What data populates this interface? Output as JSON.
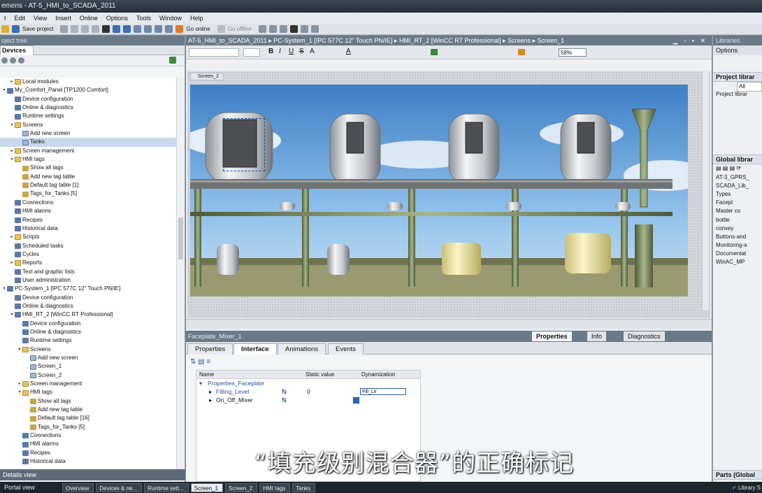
{
  "title": "emens - AT-5_HMI_to_SCADA_2011",
  "menu": [
    "t",
    "Edit",
    "View",
    "Insert",
    "Online",
    "Options",
    "Tools",
    "Window",
    "Help"
  ],
  "toolbar": {
    "save": "Save project",
    "go_online": "Go online",
    "go_offline": "Go offline"
  },
  "left": {
    "panel_title": "oject tree",
    "tab": "Devices",
    "tree": [
      {
        "label": "Local modules",
        "indent": 1,
        "icon": "f",
        "tw": "▸"
      },
      {
        "label": "My_Comfort_Panel [TP1200 Comfort]",
        "indent": 0,
        "icon": "d",
        "tw": "▾"
      },
      {
        "label": "Device configuration",
        "indent": 1,
        "icon": "d",
        "tw": ""
      },
      {
        "label": "Online & diagnostics",
        "indent": 1,
        "icon": "d",
        "tw": ""
      },
      {
        "label": "Runtime settings",
        "indent": 1,
        "icon": "d",
        "tw": ""
      },
      {
        "label": "Screens",
        "indent": 1,
        "icon": "f",
        "tw": "▾"
      },
      {
        "label": "Add new screen",
        "indent": 2,
        "icon": "s",
        "tw": ""
      },
      {
        "label": "Tanks",
        "indent": 2,
        "icon": "s",
        "tw": "",
        "selected": true
      },
      {
        "label": "Screen management",
        "indent": 1,
        "icon": "f",
        "tw": "▸"
      },
      {
        "label": "HMI tags",
        "indent": 1,
        "icon": "f",
        "tw": "▾"
      },
      {
        "label": "Show all tags",
        "indent": 2,
        "icon": "t",
        "tw": ""
      },
      {
        "label": "Add new tag table",
        "indent": 2,
        "icon": "t",
        "tw": ""
      },
      {
        "label": "Default tag table [1]",
        "indent": 2,
        "icon": "t",
        "tw": ""
      },
      {
        "label": "Tags_for_Tanks [5]",
        "indent": 2,
        "icon": "t",
        "tw": ""
      },
      {
        "label": "Connections",
        "indent": 1,
        "icon": "d",
        "tw": ""
      },
      {
        "label": "HMI alarms",
        "indent": 1,
        "icon": "d",
        "tw": ""
      },
      {
        "label": "Recipes",
        "indent": 1,
        "icon": "d",
        "tw": ""
      },
      {
        "label": "Historical data",
        "indent": 1,
        "icon": "d",
        "tw": ""
      },
      {
        "label": "Scripts",
        "indent": 1,
        "icon": "f",
        "tw": "▸"
      },
      {
        "label": "Scheduled tasks",
        "indent": 1,
        "icon": "d",
        "tw": ""
      },
      {
        "label": "Cycles",
        "indent": 1,
        "icon": "d",
        "tw": ""
      },
      {
        "label": "Reports",
        "indent": 1,
        "icon": "f",
        "tw": "▸"
      },
      {
        "label": "Text and graphic lists",
        "indent": 1,
        "icon": "d",
        "tw": ""
      },
      {
        "label": "User administration",
        "indent": 1,
        "icon": "d",
        "tw": ""
      },
      {
        "label": "PC-System_1 [IPC 577C 12\" Touch PN/IE]",
        "indent": 0,
        "icon": "d",
        "tw": "▾"
      },
      {
        "label": "Device configuration",
        "indent": 1,
        "icon": "d",
        "tw": ""
      },
      {
        "label": "Online & diagnostics",
        "indent": 1,
        "icon": "d",
        "tw": ""
      },
      {
        "label": "HMI_RT_2 [WinCC RT Professional]",
        "indent": 1,
        "icon": "d",
        "tw": "▾"
      },
      {
        "label": "Device configuration",
        "indent": 2,
        "icon": "d",
        "tw": ""
      },
      {
        "label": "Online & diagnostics",
        "indent": 2,
        "icon": "d",
        "tw": ""
      },
      {
        "label": "Runtime settings",
        "indent": 2,
        "icon": "d",
        "tw": ""
      },
      {
        "label": "Screens",
        "indent": 2,
        "icon": "f",
        "tw": "▾"
      },
      {
        "label": "Add new screen",
        "indent": 3,
        "icon": "s",
        "tw": ""
      },
      {
        "label": "Screen_1",
        "indent": 3,
        "icon": "s",
        "tw": ""
      },
      {
        "label": "Screen_2",
        "indent": 3,
        "icon": "s",
        "tw": ""
      },
      {
        "label": "Screen management",
        "indent": 2,
        "icon": "f",
        "tw": "▸"
      },
      {
        "label": "HMI tags",
        "indent": 2,
        "icon": "f",
        "tw": "▾"
      },
      {
        "label": "Show all tags",
        "indent": 3,
        "icon": "t",
        "tw": ""
      },
      {
        "label": "Add new tag table",
        "indent": 3,
        "icon": "t",
        "tw": ""
      },
      {
        "label": "Default tag table [16]",
        "indent": 3,
        "icon": "t",
        "tw": ""
      },
      {
        "label": "Tags_for_Tanks [5]",
        "indent": 3,
        "icon": "t",
        "tw": ""
      },
      {
        "label": "Connections",
        "indent": 2,
        "icon": "d",
        "tw": ""
      },
      {
        "label": "HMI alarms",
        "indent": 2,
        "icon": "d",
        "tw": ""
      },
      {
        "label": "Recipes",
        "indent": 2,
        "icon": "d",
        "tw": ""
      },
      {
        "label": "Historical data",
        "indent": 2,
        "icon": "d",
        "tw": ""
      }
    ],
    "details_view": "Details view",
    "portal_view": "Portal view"
  },
  "main": {
    "breadcrumb": [
      "AT-5_HMI_to_SCADA_2011",
      "PC-System_1 [IPC 577C 12\" Touch PN/IE]",
      "HMI_RT_2 [WinCC RT Professional]",
      "Screens",
      "Screen_1"
    ],
    "zoom": "58%",
    "screen_tab": "Screen_2",
    "object_title": "Faceplate_Mixer_1",
    "inspector_tabs": [
      "Properties",
      "Info",
      "Diagnostics"
    ],
    "prop_tabs": [
      "Properties",
      "Interface",
      "Animations",
      "Events"
    ],
    "active_prop_tab": "Interface",
    "table_headers": [
      "Name",
      "Static value",
      "Dynamization"
    ],
    "rows": [
      {
        "name": "Properties_Faceplate",
        "value": "",
        "dyn": ""
      },
      {
        "name": "Filling_Level",
        "value": "0",
        "dyn": "Fill_Le"
      },
      {
        "name": "On_Off_Mixer",
        "value": "checked",
        "dyn": ""
      }
    ]
  },
  "right": {
    "title": "Libraries",
    "options": "Options",
    "project_library": "Project librar",
    "filter": "All",
    "project_items": [
      "Project librar"
    ],
    "global_library": "Global librar",
    "global_items": [
      "AT-3_GPRS_",
      "SCADA_Lib_",
      "Types",
      "Facepl",
      "Master co",
      "bottle",
      "convey",
      "Buttons-and",
      "Monitoring-a",
      "Documentat",
      "WinAC_MP"
    ],
    "parts": "Parts (Global",
    "status": "Library S"
  },
  "taskbar": [
    "Overview",
    "Devices & ne...",
    "Runtime sett...",
    "Screen_1",
    "Screen_2",
    "HMI tags",
    "Tanks"
  ],
  "subtitle": "“填充级别混合器”的正确标记"
}
